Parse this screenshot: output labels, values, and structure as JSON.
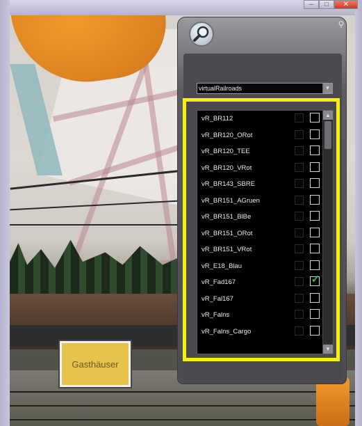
{
  "window": {
    "minimize_icon": "minimize-icon",
    "maximize_icon": "maximize-icon",
    "close_icon": "close-icon"
  },
  "scene": {
    "station_sign": "Gasthäuser"
  },
  "panel": {
    "search_icon": "magnifier-icon",
    "corner_icon": "pin-icon",
    "dropdown": {
      "selected": "virtualRailroads",
      "arrow_icon": "chevron-down-icon"
    },
    "items": [
      {
        "label": "vR_BR112",
        "checked": false
      },
      {
        "label": "vR_BR120_ORot",
        "checked": false
      },
      {
        "label": "vR_BR120_TEE",
        "checked": false
      },
      {
        "label": "vR_BR120_VRot",
        "checked": false
      },
      {
        "label": "vR_BR143_SBRE",
        "checked": false
      },
      {
        "label": "vR_BR151_AGruen",
        "checked": false
      },
      {
        "label": "vR_BR151_BlBe",
        "checked": false
      },
      {
        "label": "vR_BR151_ORot",
        "checked": false
      },
      {
        "label": "vR_BR151_VRot",
        "checked": false
      },
      {
        "label": "vR_E18_Blau",
        "checked": false
      },
      {
        "label": "vR_Fad167",
        "checked": true
      },
      {
        "label": "vR_Fal167",
        "checked": false
      },
      {
        "label": "vR_Falns",
        "checked": false
      },
      {
        "label": "vR_Falns_Cargo",
        "checked": false
      }
    ]
  },
  "colors": {
    "highlight": "#f8f200",
    "check": "#34c23a"
  }
}
